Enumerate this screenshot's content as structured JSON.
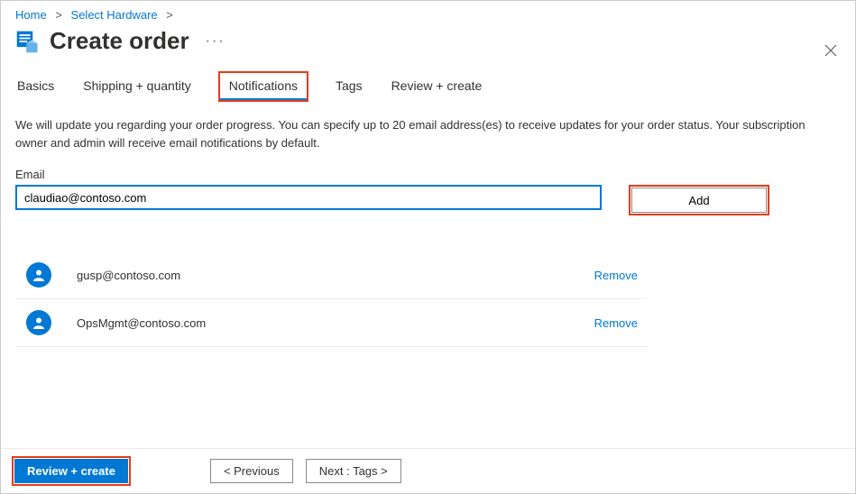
{
  "breadcrumb": {
    "home": "Home",
    "select_hardware": "Select Hardware"
  },
  "header": {
    "title": "Create order"
  },
  "tabs": {
    "basics": "Basics",
    "shipping": "Shipping + quantity",
    "notifications": "Notifications",
    "tags": "Tags",
    "review": "Review + create",
    "active": "notifications"
  },
  "notifications": {
    "description": "We will update you regarding your order progress. You can specify up to 20 email address(es) to receive updates for your order status. Your subscription owner and admin will receive email notifications by default.",
    "email_label": "Email",
    "email_value": "claudiao@contoso.com",
    "add_label": "Add",
    "remove_label": "Remove",
    "emails": [
      {
        "address": "gusp@contoso.com"
      },
      {
        "address": "OpsMgmt@contoso.com"
      }
    ]
  },
  "footer": {
    "review_create": "Review + create",
    "previous": "<  Previous",
    "next": "Next : Tags  >"
  }
}
